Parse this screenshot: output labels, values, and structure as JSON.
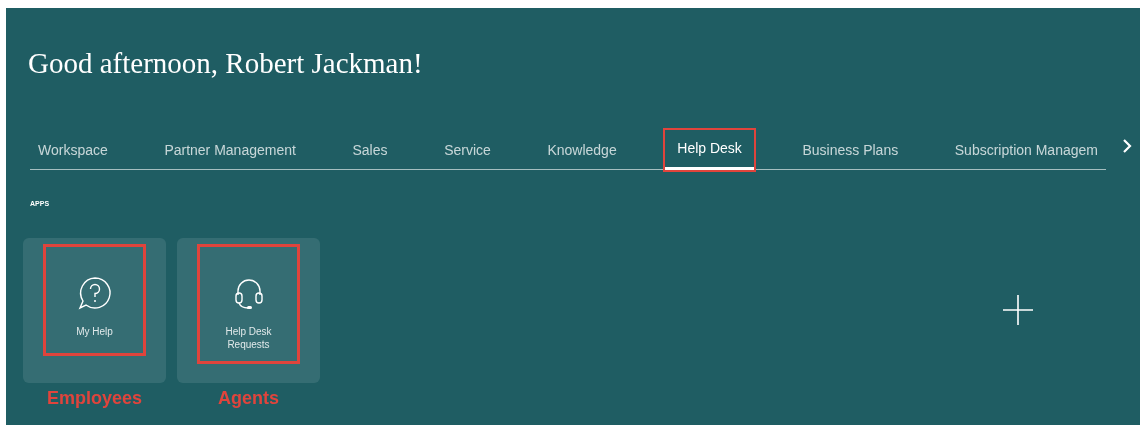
{
  "greeting": "Good afternoon, Robert Jackman!",
  "tabs": [
    {
      "label": "Workspace",
      "selected": false,
      "highlighted": false
    },
    {
      "label": "Partner Management",
      "selected": false,
      "highlighted": false
    },
    {
      "label": "Sales",
      "selected": false,
      "highlighted": false
    },
    {
      "label": "Service",
      "selected": false,
      "highlighted": false
    },
    {
      "label": "Knowledge",
      "selected": false,
      "highlighted": false
    },
    {
      "label": "Help Desk",
      "selected": true,
      "highlighted": true
    },
    {
      "label": "Business Plans",
      "selected": false,
      "highlighted": false
    },
    {
      "label": "Subscription Managem",
      "selected": false,
      "highlighted": false
    }
  ],
  "section_label": "APPS",
  "apps": [
    {
      "label": "My Help",
      "kind": "help",
      "highlighted": true,
      "caption": "Employees"
    },
    {
      "label": "Help Desk Requests",
      "kind": "headset",
      "highlighted": true,
      "caption": "Agents"
    }
  ]
}
